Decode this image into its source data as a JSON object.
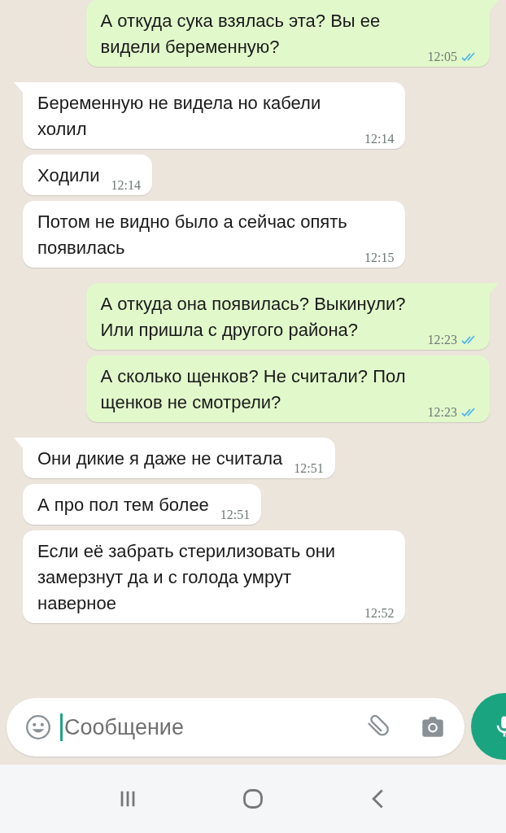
{
  "messages": [
    {
      "kind": "outgoing",
      "tail": true,
      "text": "А откуда сука взялась эта? Вы ее видели беременную?",
      "time": "12:05",
      "read": true
    },
    {
      "kind": "incoming",
      "tail": true,
      "text": "Беременную не видела но кабели холил",
      "time": "12:14"
    },
    {
      "kind": "incoming",
      "tail": false,
      "text": "Ходили",
      "time": "12:14"
    },
    {
      "kind": "incoming",
      "tail": false,
      "text": "Потом не видно было а сейчас опять появилась",
      "time": "12:15"
    },
    {
      "kind": "outgoing",
      "tail": true,
      "text": "А откуда она появилась? Выкинули? Или пришла с другого района?",
      "time": "12:23",
      "read": true
    },
    {
      "kind": "outgoing",
      "tail": false,
      "text": "А сколько щенков? Не считали? Пол щенков не смотрели?",
      "time": "12:23",
      "read": true
    },
    {
      "kind": "incoming",
      "tail": true,
      "text": "Они дикие я даже не считала",
      "time": "12:51"
    },
    {
      "kind": "incoming",
      "tail": false,
      "text": "А про пол тем более",
      "time": "12:51"
    },
    {
      "kind": "incoming",
      "tail": false,
      "text": "Если её забрать стерилизовать они замерзнут да и с голода умрут наверное",
      "time": "12:52"
    }
  ],
  "composer": {
    "placeholder": "Сообщение"
  }
}
